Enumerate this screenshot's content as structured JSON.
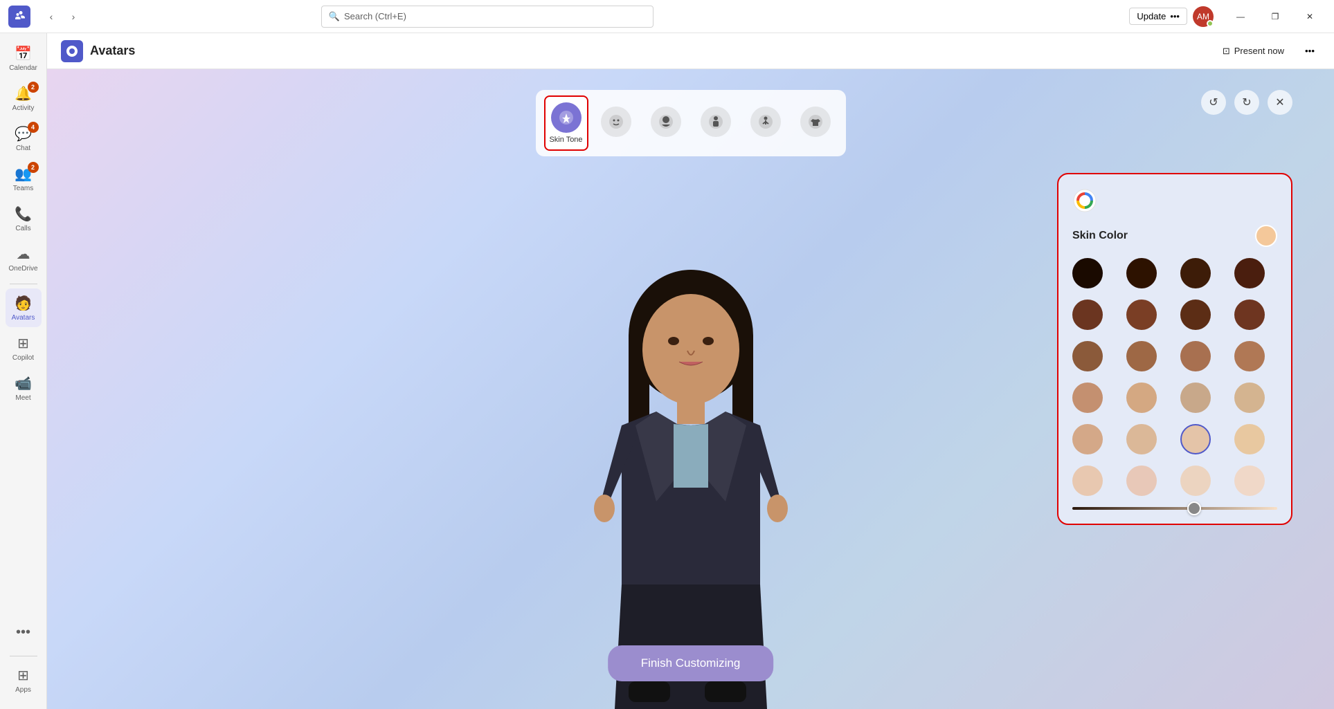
{
  "titlebar": {
    "search_placeholder": "Search (Ctrl+E)",
    "update_label": "Update",
    "update_dots": "•••",
    "profile_initials": "AM"
  },
  "window_controls": {
    "minimize": "—",
    "maximize": "❐",
    "close": "✕"
  },
  "app_header": {
    "title": "Avatars",
    "present_label": "Present now",
    "more_dots": "•••"
  },
  "sidebar": {
    "items": [
      {
        "id": "calendar",
        "label": "Calendar",
        "icon": "📅",
        "badge": null
      },
      {
        "id": "activity",
        "label": "Activity",
        "icon": "🔔",
        "badge": "2"
      },
      {
        "id": "chat",
        "label": "Chat",
        "icon": "💬",
        "badge": "4"
      },
      {
        "id": "teams",
        "label": "Teams",
        "icon": "👥",
        "badge": "2"
      },
      {
        "id": "calls",
        "label": "Calls",
        "icon": "📞",
        "badge": null
      },
      {
        "id": "onedrive",
        "label": "OneDrive",
        "icon": "☁",
        "badge": null
      },
      {
        "id": "avatars",
        "label": "Avatars",
        "icon": "🧑",
        "badge": null,
        "active": true
      },
      {
        "id": "copilot",
        "label": "Copilot",
        "icon": "⊞",
        "badge": null
      },
      {
        "id": "meet",
        "label": "Meet",
        "icon": "📹",
        "badge": null
      }
    ],
    "more_label": "•••",
    "apps_label": "Apps"
  },
  "category_toolbar": {
    "items": [
      {
        "id": "skin-tone",
        "label": "Skin Tone",
        "icon": "🎨",
        "active": true
      },
      {
        "id": "face",
        "label": "",
        "icon": "😊",
        "active": false
      },
      {
        "id": "head",
        "label": "",
        "icon": "👤",
        "active": false
      },
      {
        "id": "body",
        "label": "",
        "icon": "🕺",
        "active": false
      },
      {
        "id": "pose",
        "label": "",
        "icon": "🤸",
        "active": false
      },
      {
        "id": "clothing",
        "label": "",
        "icon": "👕",
        "active": false
      }
    ]
  },
  "toolbar_actions": {
    "undo_label": "↺",
    "redo_label": "↻",
    "close_label": "✕"
  },
  "skin_panel": {
    "title": "Skin Color",
    "selected_color": "#f4c89a",
    "colors": [
      "#1a0a00",
      "#2d1200",
      "#3d1c08",
      "#4a1e0e",
      "#6b3520",
      "#7a3e25",
      "#5c2d15",
      "#6e3520",
      "#8b5a3a",
      "#9e6845",
      "#a87050",
      "#b07855",
      "#c49070",
      "#d4a882",
      "#c8a88a",
      "#d4b490",
      "#d4a888",
      "#dbb898",
      "#e4c4a8",
      "#e8c8a0",
      "#e8c8b0",
      "#e8c8b8",
      "#ecd4c0",
      "#f0d8c8"
    ],
    "slider_value": 60
  },
  "finish_btn_label": "Finish Customizing"
}
